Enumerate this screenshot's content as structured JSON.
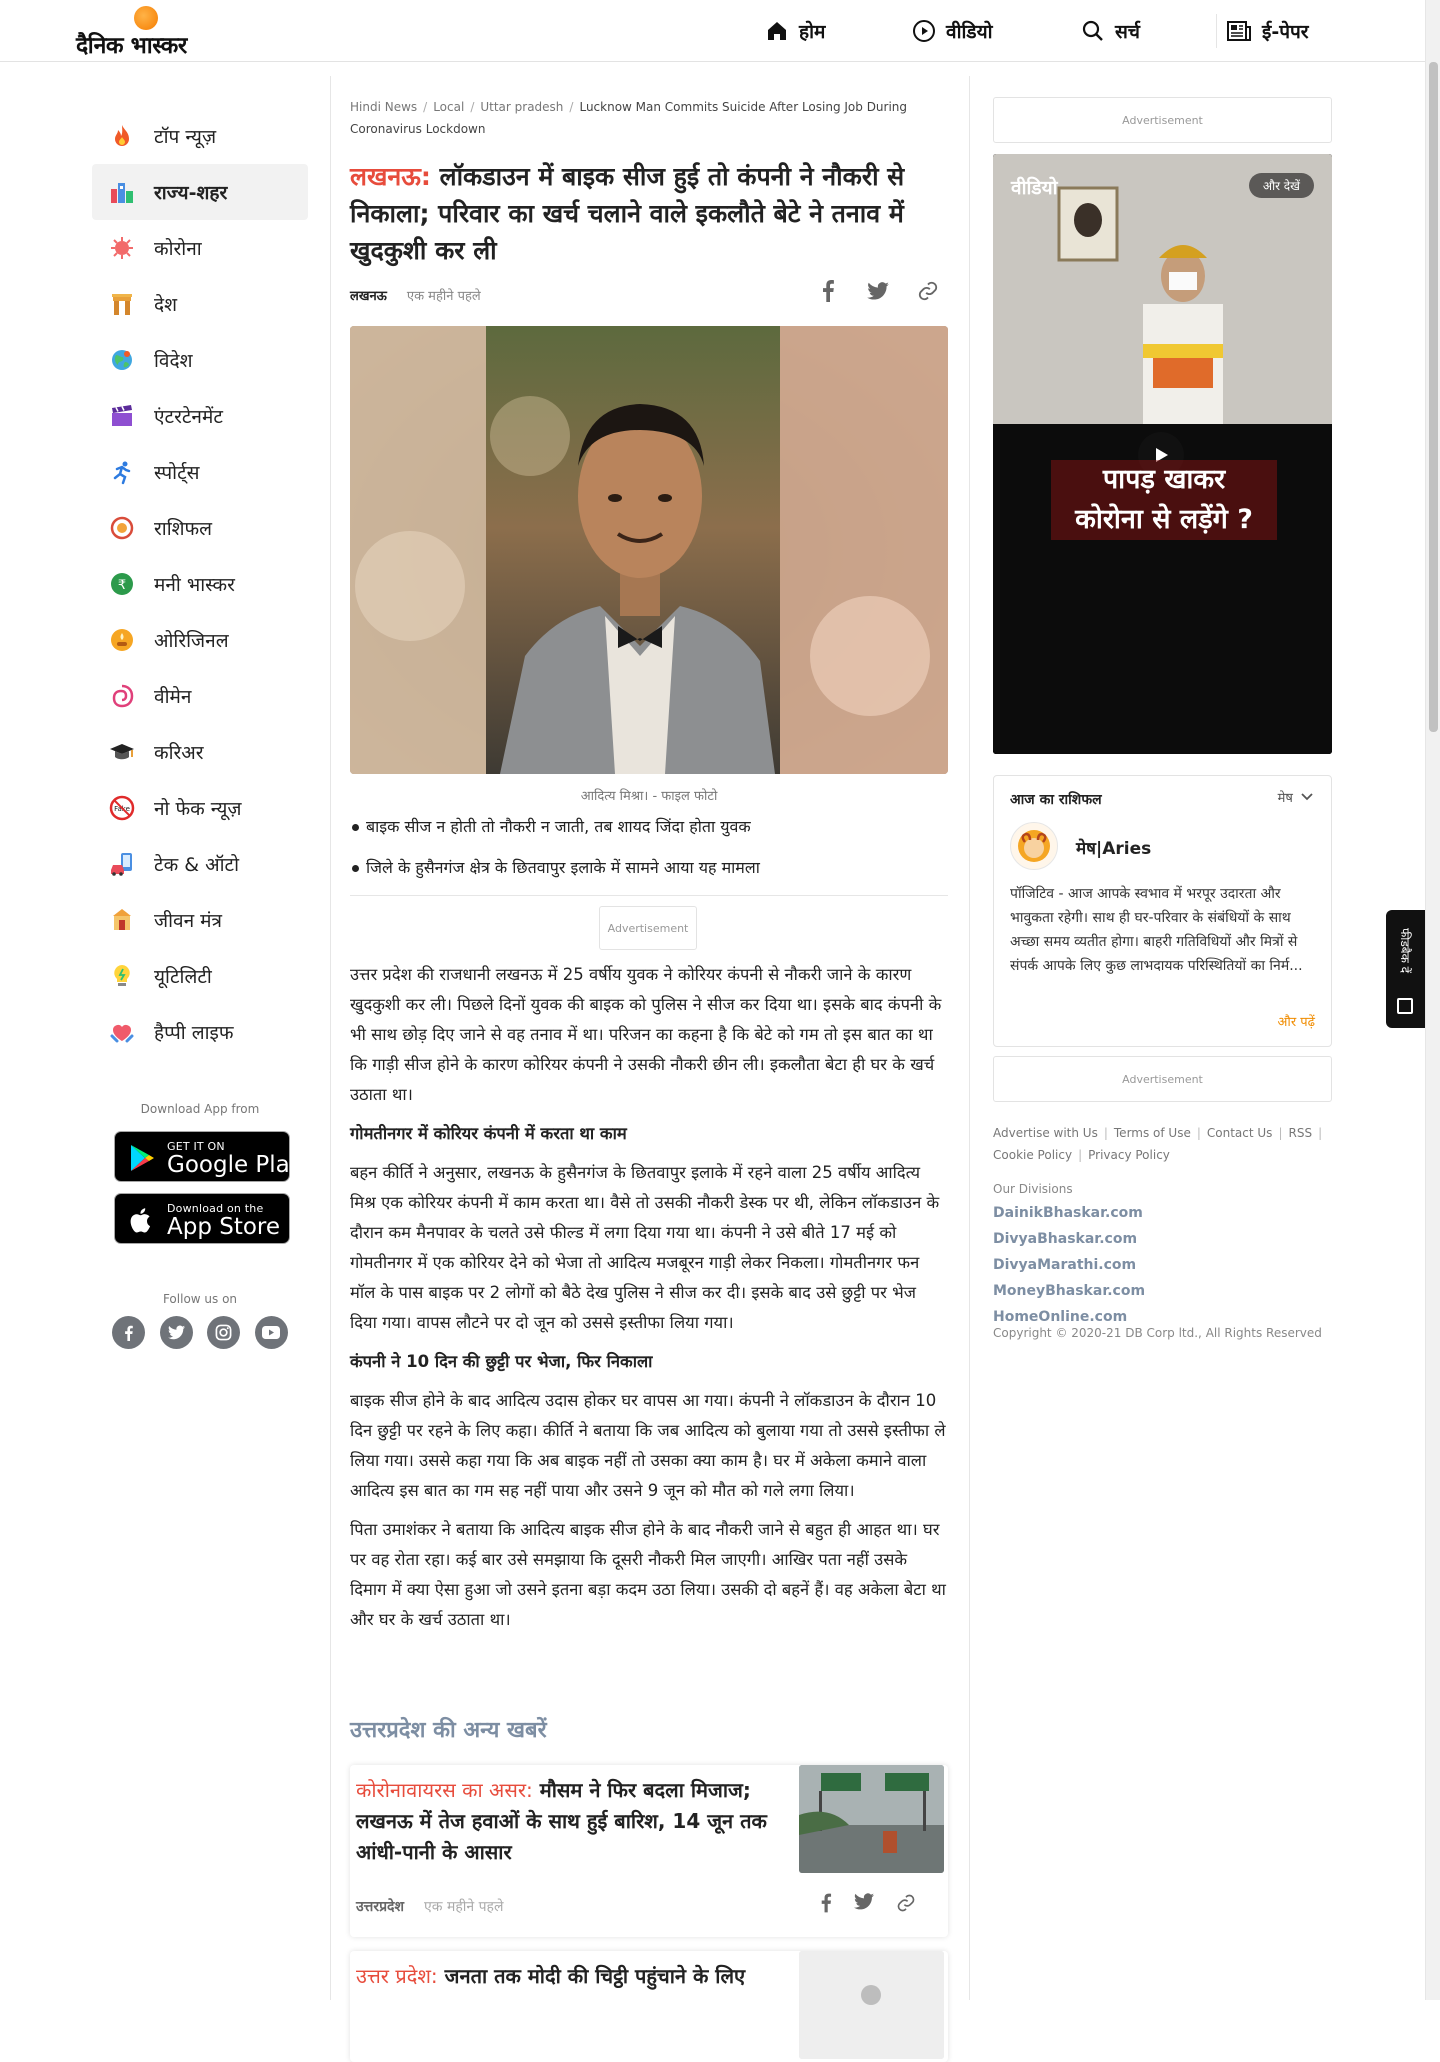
{
  "brand": {
    "logo_text": "दैनिक भास्कर"
  },
  "nav": {
    "home": "होम",
    "video": "वीडियो",
    "search": "सर्च",
    "epaper": "ई-पेपर"
  },
  "sidebar": {
    "items": [
      {
        "label": "टॉप न्यूज़",
        "icon": "flame-icon"
      },
      {
        "label": "राज्य-शहर",
        "icon": "city-icon"
      },
      {
        "label": "कोरोना",
        "icon": "virus-icon"
      },
      {
        "label": "देश",
        "icon": "india-gate-icon"
      },
      {
        "label": "विदेश",
        "icon": "globe-icon"
      },
      {
        "label": "एंटरटेनमेंट",
        "icon": "clapboard-icon"
      },
      {
        "label": "स्पोर्ट्स",
        "icon": "runner-icon"
      },
      {
        "label": "राशिफल",
        "icon": "zodiac-wheel-icon"
      },
      {
        "label": "मनी भास्कर",
        "icon": "rupee-coin-icon"
      },
      {
        "label": "ओरिजिनल",
        "icon": "lamp-icon"
      },
      {
        "label": "वीमेन",
        "icon": "swirl-icon"
      },
      {
        "label": "करिअर",
        "icon": "graduation-cap-icon"
      },
      {
        "label": "नो फेक न्यूज़",
        "icon": "no-fake-icon"
      },
      {
        "label": "टेक & ऑटो",
        "icon": "phone-car-icon"
      },
      {
        "label": "जीवन मंत्र",
        "icon": "shrine-icon"
      },
      {
        "label": "यूटिलिटी",
        "icon": "bulb-icon"
      },
      {
        "label": "हैप्पी लाइफ",
        "icon": "heart-hands-icon"
      }
    ],
    "active_label": "राज्य-शहर",
    "download_label": "Download App from",
    "google_play": {
      "small": "GET IT ON",
      "big": "Google Play"
    },
    "app_store": {
      "small": "Download on the",
      "big": "App Store"
    },
    "follow_label": "Follow us on"
  },
  "breadcrumb": {
    "items": [
      "Hindi News",
      "Local",
      "Uttar pradesh"
    ],
    "current": "Lucknow Man Commits Suicide After Losing Job During Coronavirus Lockdown"
  },
  "article": {
    "headline_prefix": "लखनऊ:",
    "headline": "लॉकडाउन में बाइक सीज हुई तो कंपनी ने नौकरी से निकाला; परिवार का खर्च चलाने वाले इकलौते बेटे ने तनाव में खुदकुशी कर ली",
    "city": "लखनऊ",
    "time": "एक महीने पहले",
    "image_caption": "आदित्य मिश्रा। - फाइल फोटो",
    "bullets": [
      "बाइक सीज न होती तो नौकरी न जाती, तब शायद जिंदा होता युवक",
      "जिले के हुसैनगंज क्षेत्र के छितवापुर इलाके में सामने आया यह मामला"
    ],
    "ad_label": "Advertisement",
    "p1": "उत्तर प्रदेश की राजधानी लखनऊ में 25 वर्षीय युवक ने कोरियर कंपनी से नौकरी जाने के कारण खुदकुशी कर ली। पिछले दिनों युवक की बाइक को पुलिस ने सीज कर दिया था। इसके बाद कंपनी के भी साथ छोड़ दिए जाने से वह तनाव में था। परिजन का कहना है कि बेटे को गम तो इस बात का था कि गाड़ी सीज होने के कारण कोरियर कंपनी ने उसकी नौकरी छीन ली। इकलौता बेटा ही घर के खर्च उठाता था।",
    "h1": "गोमतीनगर में कोरियर कंपनी में करता था काम",
    "p2": "बहन कीर्ति ने अनुसार, लखनऊ के हुसैनगंज के छितवापुर इलाके में रहने वाला 25 वर्षीय आदित्य मिश्र एक कोरियर कंपनी में काम करता था। वैसे तो उसकी नौकरी डेस्क पर थी, लेकिन लॉकडाउन के दौरान कम मैनपावर के चलते उसे फील्ड में लगा दिया गया था। कंपनी ने उसे बीते 17 मई को गोमतीनगर में एक कोरियर देने को भेजा तो आदित्य मजबूरन गाड़ी लेकर निकला। गोमतीनगर फन मॉल के पास बाइक पर 2 लोगों को बैठे देख पुलिस ने सीज कर दी। इसके बाद उसे छुट्टी पर भेज दिया गया। वापस लौटने पर दो जून को उससे इस्तीफा लिया गया।",
    "h2": "कंपनी ने 10 दिन की छुट्टी पर भेजा, फिर निकाला",
    "p3": "बाइक सीज होने के बाद आदित्य उदास होकर घर वापस आ गया। कंपनी ने लॉकडाउन के दौरान 10 दिन छुट्टी पर रहने के लिए कहा।  कीर्ति ने बताया कि जब आदित्य को बुलाया गया तो उससे इस्तीफा ले लिया गया। उससे कहा गया कि अब बाइक नहीं तो उसका क्या काम है। घर में अकेला कमाने वाला आदित्य इस बात का गम सह नहीं पाया और उसने 9 जून को मौत को गले लगा लिया।",
    "p4": "पिता उमाशंकर ने बताया कि आदित्य बाइक सीज होने के बाद नौकरी जाने से बहुत ही आहत था। घर पर वह रोता रहा। कई बार उसे समझाया कि दूसरी नौकरी मिल जाएगी। आखिर पता नहीं उसके दिमाग में क्या ऐसा हुआ जो उसने इतना बड़ा कदम उठा लिया। उसकी दो बहनें हैं। वह अकेला बेटा था और घर के खर्च उठाता था।"
  },
  "more_news": {
    "title": "उत्तरप्रदेश की अन्य खबरें",
    "cards": [
      {
        "prefix": "कोरोनावायरस का असर:",
        "title": "मौसम ने फिर बदला मिजाज; लखनऊ में तेज हवाओं के साथ हुई बारिश, 14 जून तक आंधी-पानी के आसार",
        "city": "उत्तरप्रदेश",
        "time": "एक महीने पहले"
      },
      {
        "prefix": "उत्तर प्रदेश:",
        "title": "जनता तक मोदी की चिट्ठी पहुंचाने के लिए"
      }
    ]
  },
  "right": {
    "ad_label": "Advertisement",
    "video": {
      "label": "वीडियो",
      "more": "और देखें",
      "caption_line1": "पापड़ खाकर",
      "caption_line2": "कोरोना से लड़ेंगे ?"
    },
    "rashifal": {
      "title": "आज का राशिफल",
      "selected": "मेष",
      "sign_name": "मेष|Aries",
      "text": "पॉजिटिव - आज आपके स्वभाव में भरपूर उदारता और भावुकता रहेगी। साथ ही घर-परिवार के संबंधियों के साथ अच्छा समय व्यतीत होगा। बाहरी गतिविधियों और मित्रों से संपर्क आपके लिए कुछ लाभदायक परिस्थितियों का निर्म...",
      "more": "और पढ़ें"
    },
    "footer_links": [
      "Advertise with Us",
      "Terms of Use",
      "Contact Us",
      "RSS",
      "Cookie Policy",
      "Privacy Policy"
    ],
    "divisions_label": "Our Divisions",
    "divisions": [
      "DainikBhaskar.com",
      "DivyaBhaskar.com",
      "DivyaMarathi.com",
      "MoneyBhaskar.com",
      "HomeOnline.com"
    ],
    "copyright": "Copyright © 2020-21 DB Corp ltd., All Rights Reserved"
  },
  "feedback": {
    "label": "फीडबैक दें"
  },
  "colors": {
    "accent_red": "#e74c3c",
    "muted_blue": "#7d8ea3",
    "orange": "#f08c00"
  }
}
